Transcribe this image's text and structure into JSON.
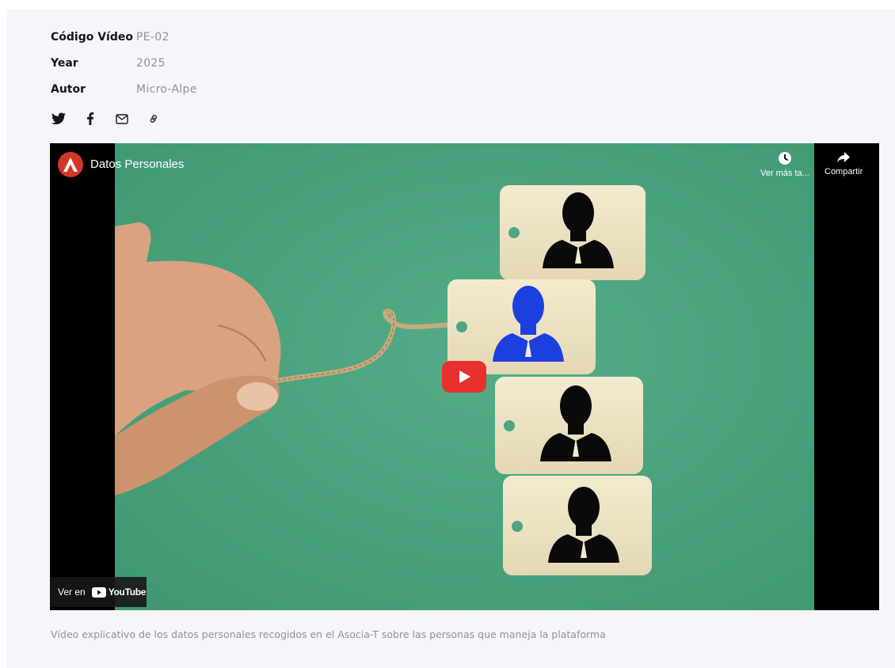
{
  "meta": {
    "rows": [
      {
        "label": "Código Vídeo",
        "value": "PE-02"
      },
      {
        "label": "Year",
        "value": "2025"
      },
      {
        "label": "Autor",
        "value": "Micro-Alpe"
      }
    ]
  },
  "share": {
    "icons": [
      "twitter-icon",
      "facebook-icon",
      "mail-icon",
      "link-icon"
    ]
  },
  "video": {
    "title": "Datos Personales",
    "watch_later": "Ver más ta...",
    "share_label": "Compartir",
    "watch_on": "Ver en",
    "youtube_word": "YouTube",
    "colors": {
      "background": "#4ea581",
      "play_button": "#e8302c",
      "highlight_person": "#1c3fe0",
      "channel_logo": "#d6362a"
    }
  },
  "caption": "Vídeo explicativo de los datos personales recogidos en el Asocia-T sobre las personas que maneja la plataforma"
}
